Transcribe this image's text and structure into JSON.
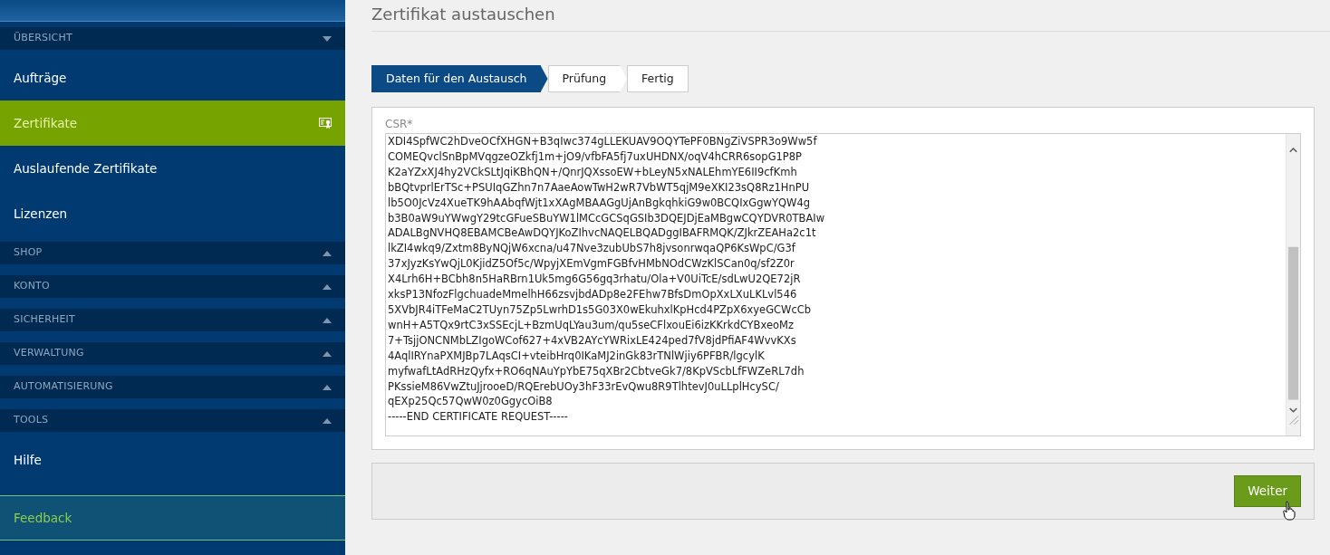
{
  "sidebar": {
    "items": [
      {
        "kind": "section",
        "label": "ÜBERSICHT",
        "expanded": true
      },
      {
        "kind": "link",
        "label": "Aufträge",
        "selected": false
      },
      {
        "kind": "link",
        "label": "Zertifikate",
        "selected": true
      },
      {
        "kind": "link",
        "label": "Auslaufende Zertifikate",
        "selected": false
      },
      {
        "kind": "link",
        "label": "Lizenzen",
        "selected": false
      },
      {
        "kind": "section",
        "label": "SHOP",
        "expanded": false
      },
      {
        "kind": "section",
        "label": "KONTO",
        "expanded": false
      },
      {
        "kind": "section",
        "label": "SICHERHEIT",
        "expanded": false
      },
      {
        "kind": "section",
        "label": "VERWALTUNG",
        "expanded": false
      },
      {
        "kind": "section",
        "label": "AUTOMATISIERUNG",
        "expanded": false
      },
      {
        "kind": "section",
        "label": "TOOLS",
        "expanded": false
      },
      {
        "kind": "link",
        "label": "Hilfe",
        "selected": false
      },
      {
        "kind": "feedback",
        "label": "Feedback"
      }
    ]
  },
  "page_title": "Zertifikat austauschen",
  "steps": [
    {
      "label": "Daten für den Austausch",
      "selected": true
    },
    {
      "label": "Prüfung",
      "selected": false
    },
    {
      "label": "Fertig",
      "selected": false
    }
  ],
  "csr": {
    "label": "CSR*",
    "value": [
      "XDI4SpfWC2hDveOCfXHGN+B3qIwc374gLLEKUAV9OQYTePF0BNgZiVSPR3o9Ww5f",
      "COMEQvclSnBpMVqgzeOZkfj1m+jO9/vfbFA5fj7uxUHDNX/oqV4hCRR6sopG1P8P",
      "K2aYZxXJ4hy2VCkSLtJqiKBhQN+/QnrJQXssoEW+bLeyN5xNALEhmYE6II9cfKmh",
      "bBQtvprlErTSc+PSUIqGZhn7n7AaeAowTwH2wR7VbWT5qjM9eXKI23sQ8Rz1HnPU",
      "lb5O0JcVz4XueTK9hAAbqfWjt1xXAgMBAAGgUjAnBgkqhkiG9w0BCQIxGgwYQW4g",
      "b3B0aW9uYWwgY29tcGFueSBuYW1lMCcGCSqGSIb3DQEJDjEaMBgwCQYDVR0TBAIw",
      "ADALBgNVHQ8EBAMCBeAwDQYJKoZIhvcNAQELBQADggIBAFRMQK/ZJkrZEAHa2c1t",
      "lkZI4wkq9/Zxtm8ByNQjW6xcna/u47Nve3zubUbS7h8jvsonrwqaQP6KsWpC/G3f",
      "37xJyzKsYwQjL0KjidZ5Of5c/WpyjXEmVgmFGBfvHMbNOdCWzKlSCan0q/sf2Z0r",
      "X4Lrh6H+BCbh8n5HaRBrn1Uk5mg6G56gq3rhatu/Ola+V0UiTcE/sdLwU2QE72jR",
      "xksP13NfozFlgchuadeMmelhH66zsvjbdADp8e2FEhw7BfsDmOpXxLXuLKLvl546",
      "5XVbJR4iTFeMaC2TUyn75Zp5LwrhD1s5G03X0wEkuhxlKpHcd4PZpX6xyeGCWcCb",
      "wnH+A5TQx9rtC3xSSEcjL+BzmUqLYau3um/qu5seCFlxouEi6izKKrkdCYBxeoMz",
      "7+TsjjONCNMbLZIgoWCof627+4xVB2AYcYWRixLE424ped7fV8jdPfiAF4WvvKXs",
      "4AqlIRYnaPXMJBp7LAqsCI+vteibHrq0IKaMJ2inGk83rTNlWjiy6PFBR/lgcylK",
      "myfwafLtAdRHzQyfx+RO6qNAuYpYbE75qXBr2CbtveGk7/8KpVScbLfFWZeRL7dh",
      "PKssieM86VwZtuJjrooeD/RQErebUOy3hF33rEvQwu8R9TlhtevJ0uLLplHcySC/",
      "qEXp25Qc57QwW0z0GgycOiB8",
      "-----END CERTIFICATE REQUEST-----"
    ]
  },
  "next_button": "Weiter"
}
